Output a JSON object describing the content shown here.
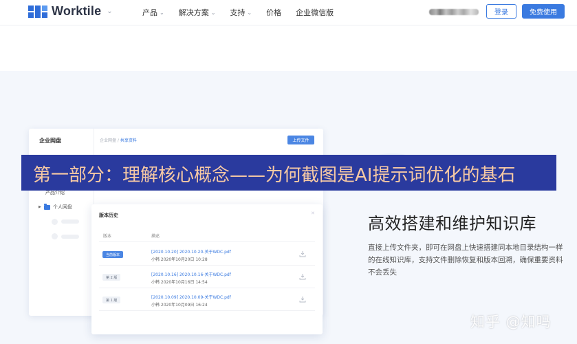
{
  "header": {
    "brand": "Worktile",
    "nav": [
      {
        "label": "产品",
        "has_dropdown": true
      },
      {
        "label": "解决方案",
        "has_dropdown": true
      },
      {
        "label": "支持",
        "has_dropdown": true
      },
      {
        "label": "价格",
        "has_dropdown": false
      },
      {
        "label": "企业微信版",
        "has_dropdown": false
      }
    ],
    "login_label": "登录",
    "signup_label": "免费使用",
    "accent_color": "#3a7ae0"
  },
  "mock": {
    "sidebar_title": "企业网盘",
    "tree": [
      {
        "label": "产品介绍"
      },
      {
        "label": "个人网盘"
      }
    ],
    "breadcrumb_root": "企业网盘 /",
    "breadcrumb_current": "共享资料",
    "upload_label": "上传文件",
    "panel_title": "版本历史",
    "col_version": "版本",
    "col_desc": "描述",
    "versions": [
      {
        "tag": "当前版本",
        "file": "[2020.10.20] 2020.10.20-关于WDC.pdf",
        "meta": "小韩 2020年10月20日 10:28"
      },
      {
        "tag": "第 2 版",
        "file": "[2020.10.16] 2020.10.16-关于WDC.pdf",
        "meta": "小韩 2020年10月16日 14:54"
      },
      {
        "tag": "第 1 版",
        "file": "[2020.10.09] 2020.10.09-关于WDC.pdf",
        "meta": "小韩 2020年10月09日 16:24"
      }
    ]
  },
  "feature": {
    "title": "高效搭建和维护知识库",
    "description": "直接上传文件夹，即可在网盘上快速搭建同本地目录结构一样的在线知识库，支持文件删除恢复和版本回溯，确保重要资料不会丢失"
  },
  "banner": {
    "text": "第一部分：理解核心概念——为何截图是AI提示词优化的基石",
    "bg_color": "#2a3a9e",
    "text_color": "#f6c9a4"
  },
  "watermark": "知乎 @知吗"
}
